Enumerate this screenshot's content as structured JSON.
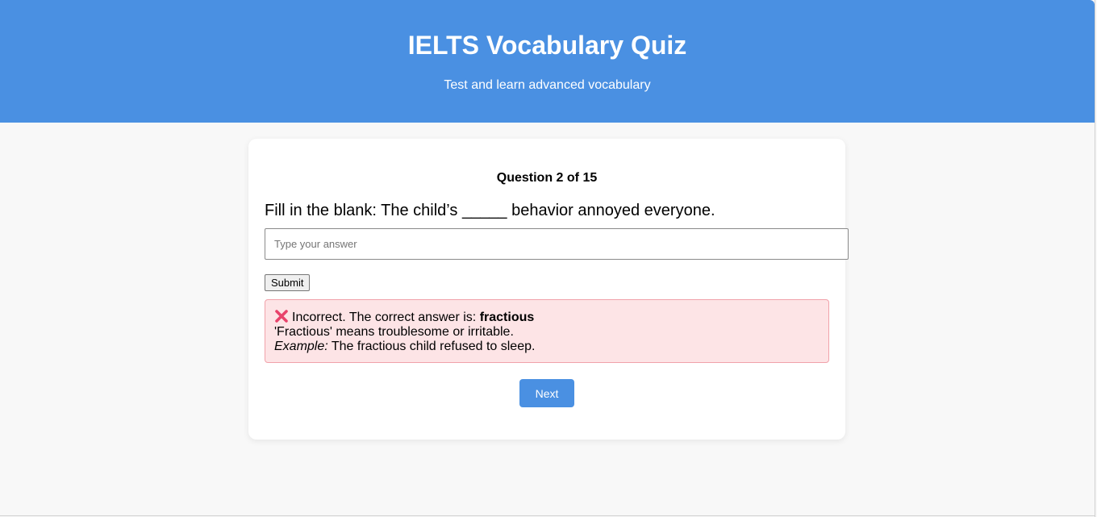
{
  "header": {
    "title": "IELTS Vocabulary Quiz",
    "subtitle": "Test and learn advanced vocabulary"
  },
  "quiz": {
    "counter": "Question 2 of 15",
    "question": "Fill in the blank: The child’s _____ behavior annoyed everyone.",
    "answer_input": {
      "value": "",
      "placeholder": "Type your answer"
    },
    "submit_label": "Submit",
    "feedback": {
      "status_icon": "cross-mark-icon",
      "incorrect_prefix": "Incorrect. The correct answer is:",
      "correct_answer": "fractious",
      "definition": "'Fractious' means troublesome or irritable.",
      "example_label": "Example:",
      "example_text": "The fractious child refused to sleep."
    },
    "next_label": "Next"
  },
  "colors": {
    "accent": "#4a90e2",
    "error_background": "#fde4e6",
    "error_border": "#f1a2aa",
    "cross_icon": "#e8426b"
  }
}
